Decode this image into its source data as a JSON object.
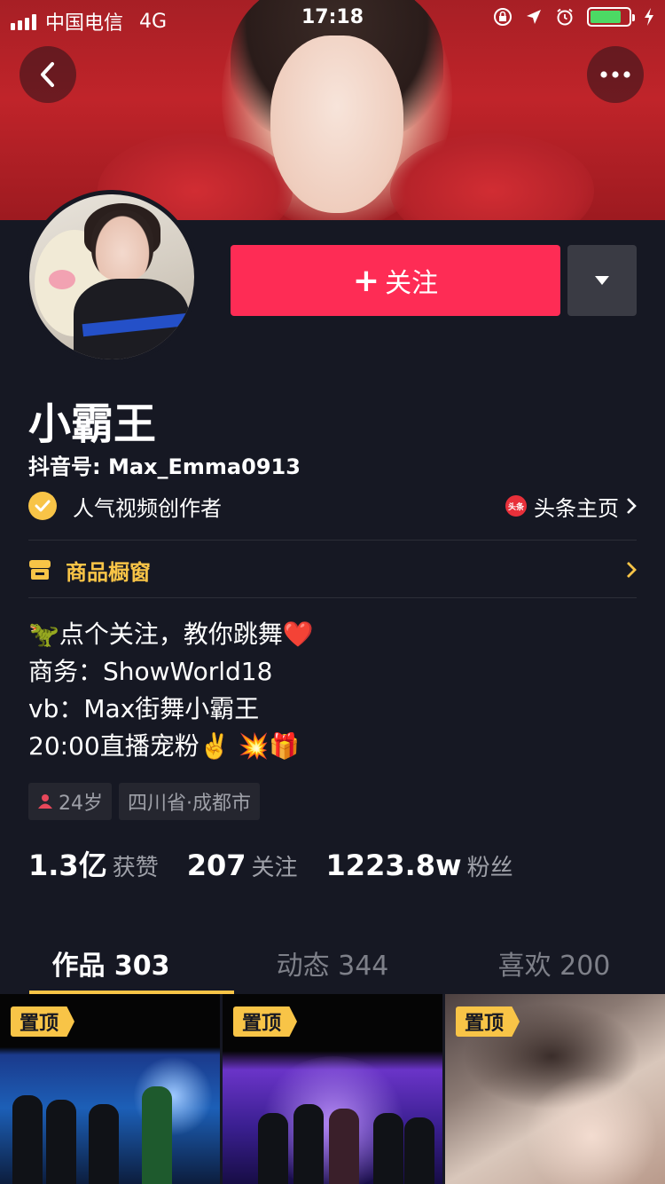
{
  "status_bar": {
    "carrier": "中国电信",
    "network": "4G",
    "time": "17:18",
    "battery_level": 0.8
  },
  "profile": {
    "follow_label": "关注",
    "name": "小霸王",
    "douyin_id": "抖音号: Max_Emma0913",
    "verified_label": "人气视频创作者",
    "toutiao_label": "头条主页",
    "toutiao_logo_text": "头条",
    "shop_label": "商品橱窗",
    "bio": [
      "🦖点个关注，教你跳舞❤️",
      "商务：ShowWorld18",
      "vb：Max街舞小霸王",
      "20:00直播宠粉✌️ 💥🎁"
    ],
    "tags": {
      "age": "24岁",
      "location": "四川省·成都市"
    },
    "stats": [
      {
        "num": "1.3亿",
        "label": "获赞"
      },
      {
        "num": "207",
        "label": "关注"
      },
      {
        "num": "1223.8w",
        "label": "粉丝"
      }
    ]
  },
  "tabs": [
    {
      "label": "作品 303",
      "active": true
    },
    {
      "label": "动态 344",
      "active": false
    },
    {
      "label": "喜欢 200",
      "active": false
    }
  ],
  "videos": [
    {
      "pin_label": "置顶"
    },
    {
      "pin_label": "置顶"
    },
    {
      "pin_label": "置顶"
    }
  ],
  "colors": {
    "background": "#161823",
    "follow_button": "#fe2c55",
    "accent_yellow": "#f8c447",
    "muted_text": "#9ea0a8"
  },
  "icons": [
    "back-icon",
    "more-icon",
    "dropdown-icon",
    "verified-icon",
    "toutiao-icon",
    "shop-icon",
    "chevron-right-icon",
    "person-icon",
    "signal-icon",
    "lock-rotation-icon",
    "location-icon",
    "alarm-icon",
    "battery-icon",
    "charging-icon"
  ]
}
